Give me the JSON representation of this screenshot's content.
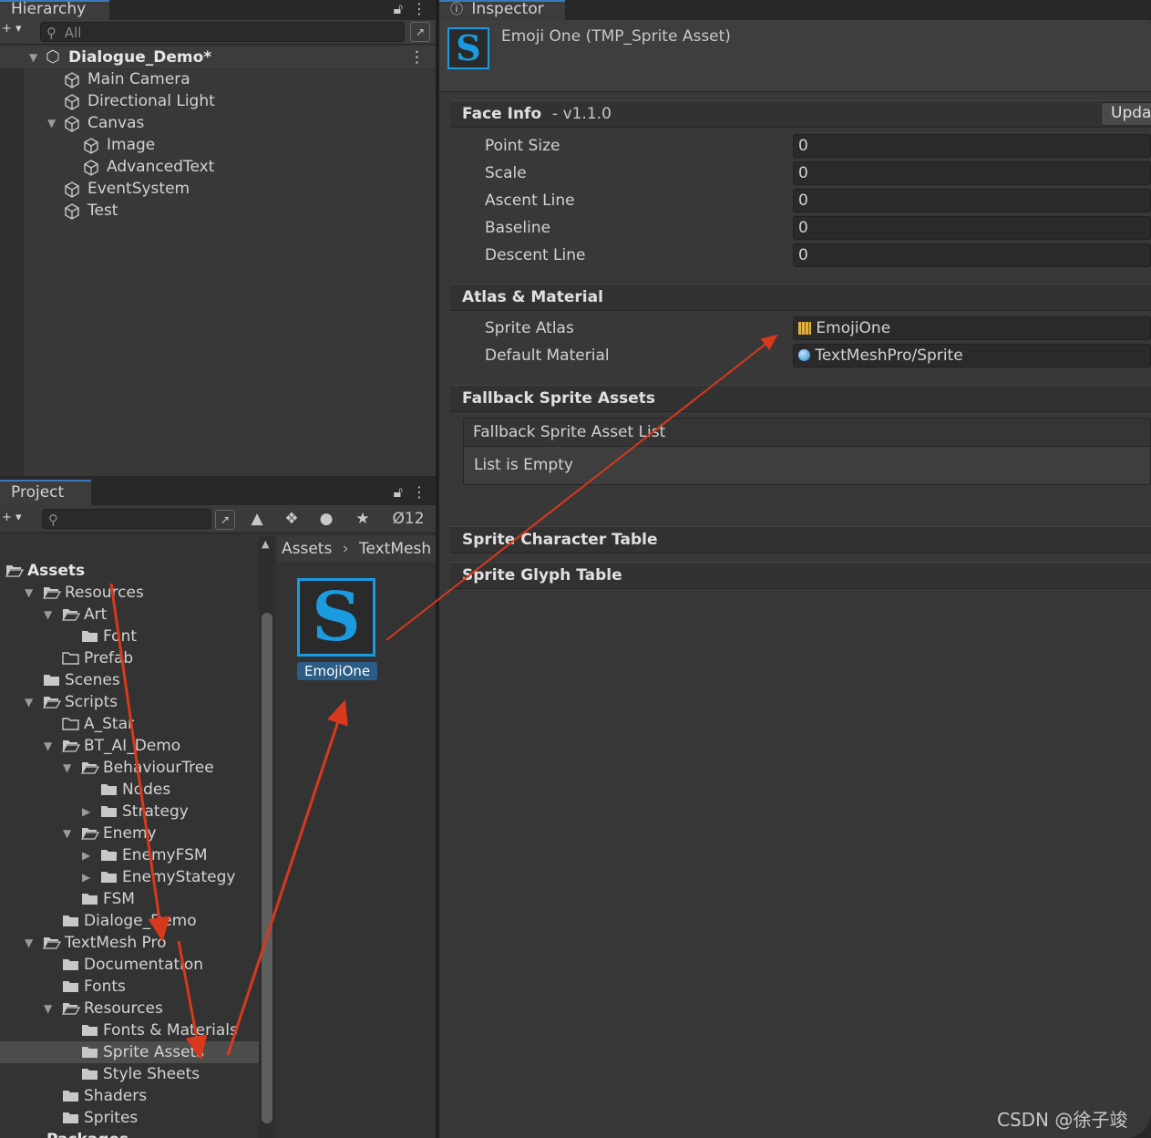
{
  "hierarchy": {
    "tab": "Hierarchy",
    "search_placeholder": "All",
    "scene": "Dialogue_Demo*",
    "items": [
      {
        "label": "Main Camera"
      },
      {
        "label": "Directional Light"
      },
      {
        "label": "Canvas"
      },
      {
        "label": "Image"
      },
      {
        "label": "AdvancedText"
      },
      {
        "label": "EventSystem"
      },
      {
        "label": "Test"
      }
    ]
  },
  "project": {
    "tab": "Project",
    "hidden_count": "12",
    "breadcrumb": [
      "Assets",
      "TextMesh"
    ],
    "asset_label": "EmojiOne",
    "asset_glyph": "S",
    "tree": [
      {
        "label": "Assets"
      },
      {
        "label": "Resources"
      },
      {
        "label": "Art"
      },
      {
        "label": "Font"
      },
      {
        "label": "Prefab"
      },
      {
        "label": "Scenes"
      },
      {
        "label": "Scripts"
      },
      {
        "label": "A_Star"
      },
      {
        "label": "BT_AI_Demo"
      },
      {
        "label": "BehaviourTree"
      },
      {
        "label": "Nodes"
      },
      {
        "label": "Strategy"
      },
      {
        "label": "Enemy"
      },
      {
        "label": "EnemyFSM"
      },
      {
        "label": "EnemyStategy"
      },
      {
        "label": "FSM"
      },
      {
        "label": "Dialoge_Demo"
      },
      {
        "label": "TextMesh Pro"
      },
      {
        "label": "Documentation"
      },
      {
        "label": "Fonts"
      },
      {
        "label": "Resources"
      },
      {
        "label": "Fonts & Materials"
      },
      {
        "label": "Sprite Assets"
      },
      {
        "label": "Style Sheets"
      },
      {
        "label": "Shaders"
      },
      {
        "label": "Sprites"
      },
      {
        "label": "Packages"
      }
    ]
  },
  "inspector": {
    "tab": "Inspector",
    "title": "Emoji One (TMP_Sprite Asset)",
    "face_info": {
      "header": "Face Info",
      "version": "- v1.1.0",
      "update_button": "Upda",
      "fields": [
        {
          "label": "Point Size",
          "value": "0"
        },
        {
          "label": "Scale",
          "value": "0"
        },
        {
          "label": "Ascent Line",
          "value": "0"
        },
        {
          "label": "Baseline",
          "value": "0"
        },
        {
          "label": "Descent Line",
          "value": "0"
        }
      ]
    },
    "atlas": {
      "header": "Atlas & Material",
      "sprite_atlas_label": "Sprite Atlas",
      "sprite_atlas_value": "EmojiOne",
      "default_material_label": "Default Material",
      "default_material_value": "TextMeshPro/Sprite"
    },
    "fallback": {
      "header": "Fallback Sprite Assets",
      "list_title": "Fallback Sprite Asset List",
      "empty_text": "List is Empty"
    },
    "sprite_character_table": "Sprite Character Table",
    "sprite_glyph_table": "Sprite Glyph Table"
  },
  "watermark": "CSDN @徐子竣",
  "colors": {
    "selection": "#4d4d4d",
    "annotation_arrow": "#d8391c",
    "asset_icon_blue": "#1a9be0",
    "tab_accent": "#3a79bb"
  }
}
